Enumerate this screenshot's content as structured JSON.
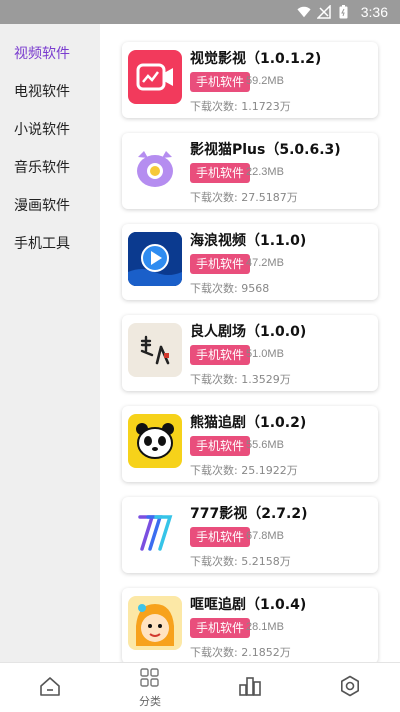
{
  "status_bar": {
    "time": "3:36",
    "icons": [
      "wifi-icon",
      "signal-icon",
      "battery-icon"
    ]
  },
  "sidebar": {
    "items": [
      {
        "label": "视频软件",
        "active": true
      },
      {
        "label": "电视软件",
        "active": false
      },
      {
        "label": "小说软件",
        "active": false
      },
      {
        "label": "音乐软件",
        "active": false
      },
      {
        "label": "漫画软件",
        "active": false
      },
      {
        "label": "手机工具",
        "active": false
      }
    ]
  },
  "apps": [
    {
      "title": "视觉影视（1.0.1.2)",
      "tag": "手机软件",
      "size": "59.2MB",
      "downloads": "下载次数: 1.1723万",
      "icon": "video-camera-icon"
    },
    {
      "title": "影视猫Plus（5.0.6.3)",
      "tag": "手机软件",
      "size": "22.3MB",
      "downloads": "下载次数: 27.5187万",
      "icon": "cat-icon"
    },
    {
      "title": "海浪视频（1.1.0)",
      "tag": "手机软件",
      "size": "47.2MB",
      "downloads": "下载次数: 9568",
      "icon": "play-icon"
    },
    {
      "title": "良人剧场（1.0.0)",
      "tag": "手机软件",
      "size": "51.0MB",
      "downloads": "下载次数: 1.3529万",
      "icon": "calligraphy-icon",
      "icon_text": "良人"
    },
    {
      "title": "熊猫追剧（1.0.2)",
      "tag": "手机软件",
      "size": "55.6MB",
      "downloads": "下载次数: 25.1922万",
      "icon": "panda-icon"
    },
    {
      "title": "777影视（2.7.2)",
      "tag": "手机软件",
      "size": "67.8MB",
      "downloads": "下载次数: 5.2158万",
      "icon": "seven-icon"
    },
    {
      "title": "哐哐追剧（1.0.4)",
      "tag": "手机软件",
      "size": "28.1MB",
      "downloads": "下载次数: 2.1852万",
      "icon": "cartoon-girl-icon"
    }
  ],
  "tab_bar": {
    "tabs": [
      {
        "icon": "home-icon",
        "label": ""
      },
      {
        "icon": "category-icon",
        "label": "分类"
      },
      {
        "icon": "ranking-icon",
        "label": ""
      },
      {
        "icon": "settings-icon",
        "label": ""
      }
    ]
  },
  "colors": {
    "accent": "#7a3ccf",
    "tag": "#e94e7c",
    "sidebar_bg": "#efefef"
  }
}
